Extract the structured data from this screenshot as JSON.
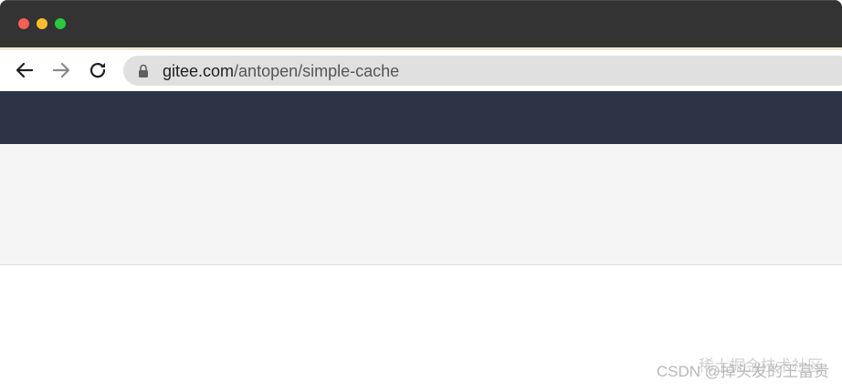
{
  "browser": {
    "url_host": "gitee.com",
    "url_path": "/antopen/simple-cache"
  },
  "watermark": {
    "text": "CSDN @掉头发的王富贵",
    "overlay_text": "稀土掘金技术社区"
  },
  "icons": {
    "back": "arrow-left-icon",
    "forward": "arrow-right-icon",
    "reload": "reload-icon",
    "lock": "lock-icon"
  },
  "colors": {
    "titlebar": "#333333",
    "close": "#f45f57",
    "minimize": "#fbbc2f",
    "maximize": "#2ac940",
    "site_header": "#2e3446",
    "site_band": "#f5f5f5"
  }
}
